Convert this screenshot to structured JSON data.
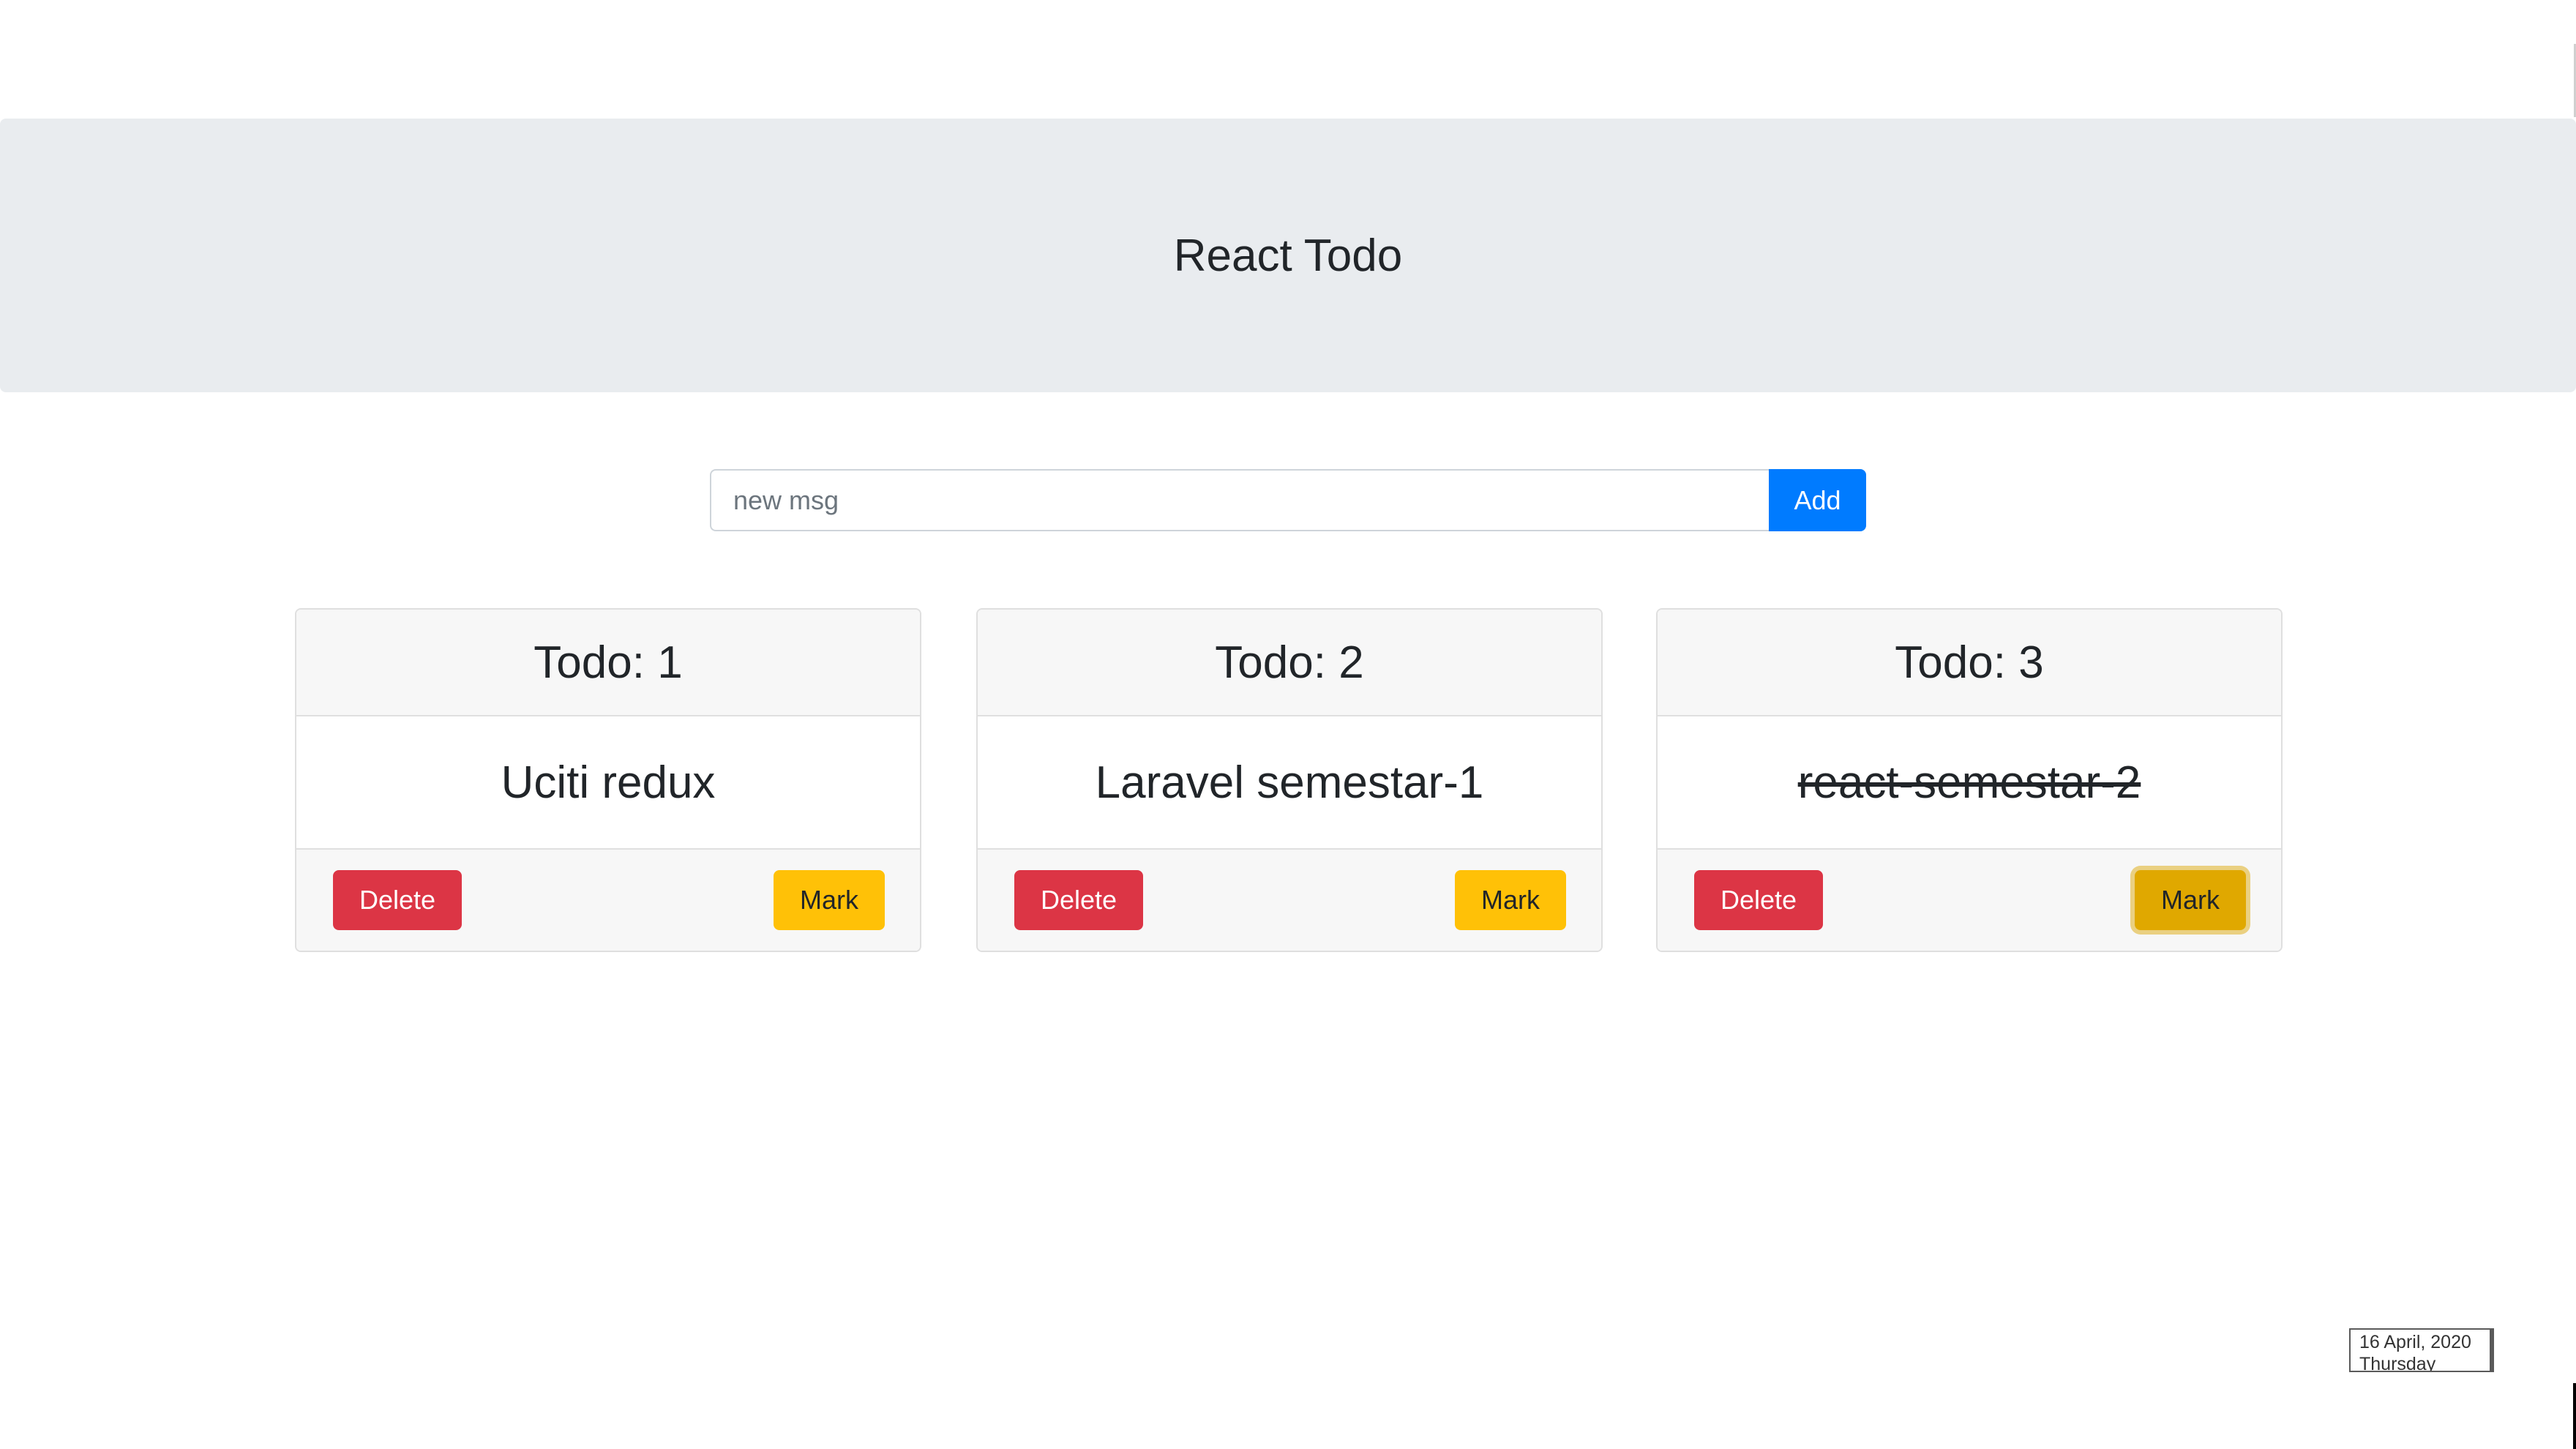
{
  "header": {
    "title": "React Todo"
  },
  "new_todo": {
    "placeholder": "new msg",
    "value": "",
    "add_label": "Add"
  },
  "todos": [
    {
      "header": "Todo: 1",
      "text": "Uciti redux",
      "done": false,
      "delete_label": "Delete",
      "mark_label": "Mark"
    },
    {
      "header": "Todo: 2",
      "text": "Laravel semestar-1",
      "done": false,
      "delete_label": "Delete",
      "mark_label": "Mark"
    },
    {
      "header": "Todo: 3",
      "text": "react-semestar-2",
      "done": true,
      "delete_label": "Delete",
      "mark_label": "Mark"
    }
  ],
  "date_widget": {
    "date": "16 April, 2020",
    "weekday": "Thursday"
  },
  "colors": {
    "jumbotron_bg": "#e9ecef",
    "primary": "#007bff",
    "danger": "#dc3545",
    "warning": "#ffc107"
  }
}
